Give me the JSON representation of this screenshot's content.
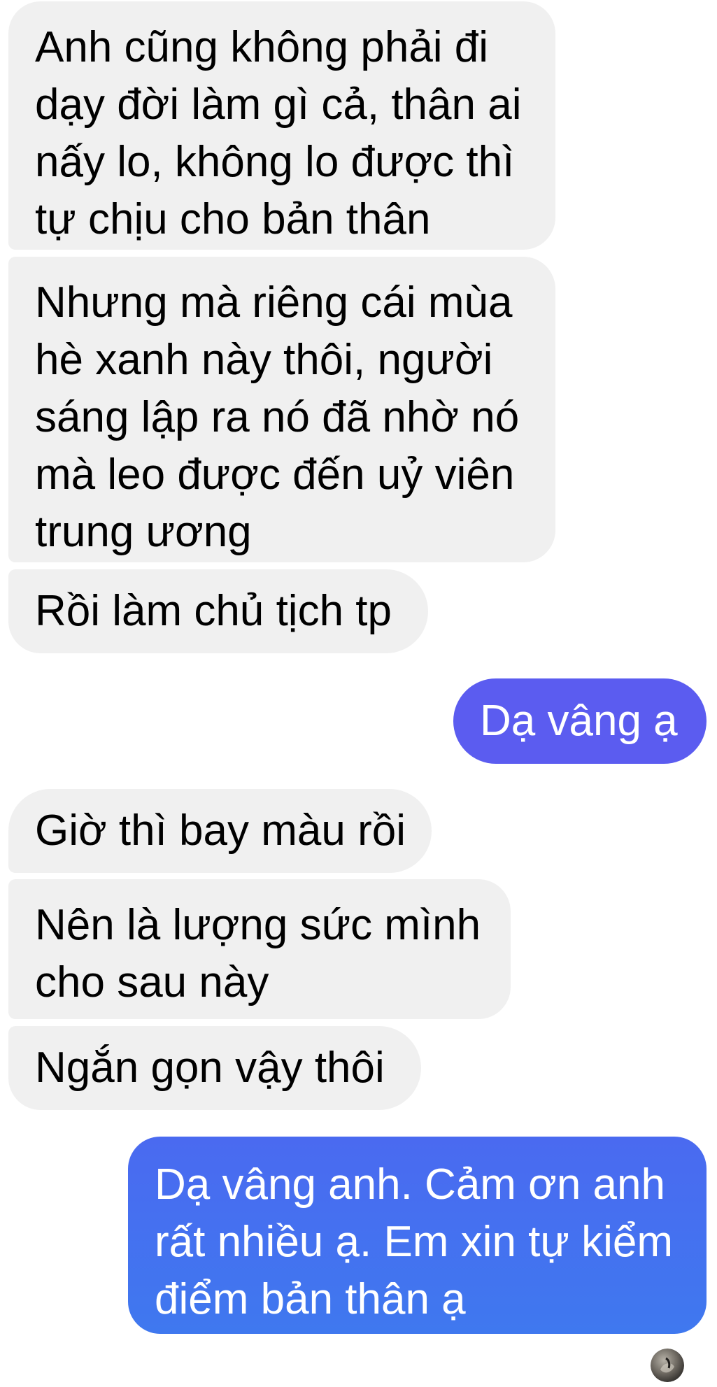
{
  "conversation": {
    "messages": [
      {
        "sender": "incoming",
        "lines": [
          "Anh cũng không phải đi",
          "dạy đời làm gì cả, thân ai",
          "nấy lo, không lo được thì",
          "tự chịu cho bản thân"
        ]
      },
      {
        "sender": "incoming",
        "lines": [
          "Nhưng mà riêng cái mùa",
          "hè xanh này thôi, người",
          "sáng lập ra nó đã nhờ nó",
          "mà leo được đến uỷ viên",
          "trung ương"
        ]
      },
      {
        "sender": "incoming",
        "lines": [
          "Rồi làm chủ tịch tp"
        ]
      },
      {
        "sender": "outgoing",
        "lines": [
          "Dạ vâng ạ"
        ]
      },
      {
        "sender": "incoming",
        "lines": [
          "Giờ thì bay màu rồi"
        ]
      },
      {
        "sender": "incoming",
        "lines": [
          "Nên là lượng sức mình",
          "cho sau này"
        ]
      },
      {
        "sender": "incoming",
        "lines": [
          "Ngắn gọn vậy thôi"
        ]
      },
      {
        "sender": "outgoing",
        "lines": [
          "Dạ vâng anh. Cảm ơn anh",
          "rất nhiều ạ. Em xin tự kiểm",
          "điểm bản thân ạ"
        ]
      }
    ],
    "read_receipt_icon": "user-avatar-icon"
  },
  "colors": {
    "incoming_bubble": "#f0f0f0",
    "outgoing_bubble_top": "#5b5cf0",
    "outgoing_bubble_bottom": "#3f78ef",
    "outgoing_text": "#ffffff",
    "incoming_text": "#000000"
  }
}
